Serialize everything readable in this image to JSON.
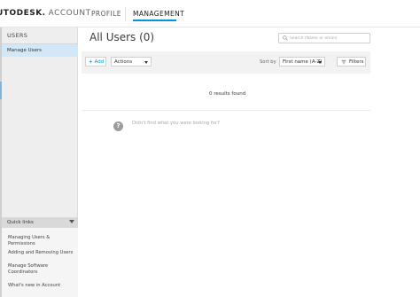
{
  "header": {
    "brand_main": "UTODESK.",
    "brand_sub": "ACCOUNT",
    "tabs": [
      {
        "label": "PROFILE"
      },
      {
        "label": "MANAGEMENT"
      }
    ],
    "accent": "#0696d7"
  },
  "sidebar": {
    "title": "USERS",
    "items": [
      {
        "label": "Manage Users"
      }
    ],
    "quick_links": {
      "label": "Quick links",
      "links": [
        "Managing Users & Permissions",
        "Adding and Removing Users",
        "Manage Software Coordinators",
        "What's new in Account"
      ]
    }
  },
  "main": {
    "title": "All Users (0)",
    "search": {
      "placeholder": "Search (Name or email)",
      "icon": "search-icon"
    },
    "toolbar": {
      "add_label": "Add",
      "actions_label": "Actions",
      "sort_by_label": "Sort by",
      "sort_value": "First name (A-Z)",
      "filters_label": "Filters"
    },
    "results_text": "0 results found",
    "help_text": "Didn't find what you were looking for?"
  }
}
